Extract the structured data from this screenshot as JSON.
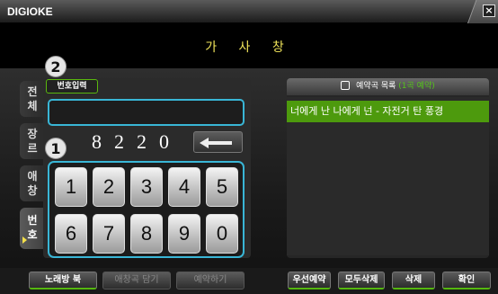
{
  "app": {
    "title": "DIGIOKE",
    "close_label": "×"
  },
  "lyrics": {
    "text": "가 사 창"
  },
  "side_tabs": [
    {
      "chars": [
        "전",
        "체"
      ]
    },
    {
      "chars": [
        "장",
        "르"
      ]
    },
    {
      "chars": [
        "애",
        "창"
      ]
    },
    {
      "chars": [
        "번",
        "호"
      ]
    }
  ],
  "number_panel": {
    "tab_label": "번호입력",
    "name_value": "",
    "number_value": "8220",
    "keys": [
      "1",
      "2",
      "3",
      "4",
      "5",
      "6",
      "7",
      "8",
      "9",
      "0"
    ]
  },
  "queue": {
    "header_label": "예약곡 목록",
    "header_count": "(1곡 예약)",
    "items": [
      "너에게 난 나에게 넌 - 자전거 탄 풍경"
    ]
  },
  "bottom_left": [
    "노래방 북",
    "애창곡 담기",
    "예약하기"
  ],
  "bottom_right": [
    "우선예약",
    "모두삭제",
    "삭제",
    "확인"
  ],
  "badges": [
    "2",
    "1"
  ]
}
